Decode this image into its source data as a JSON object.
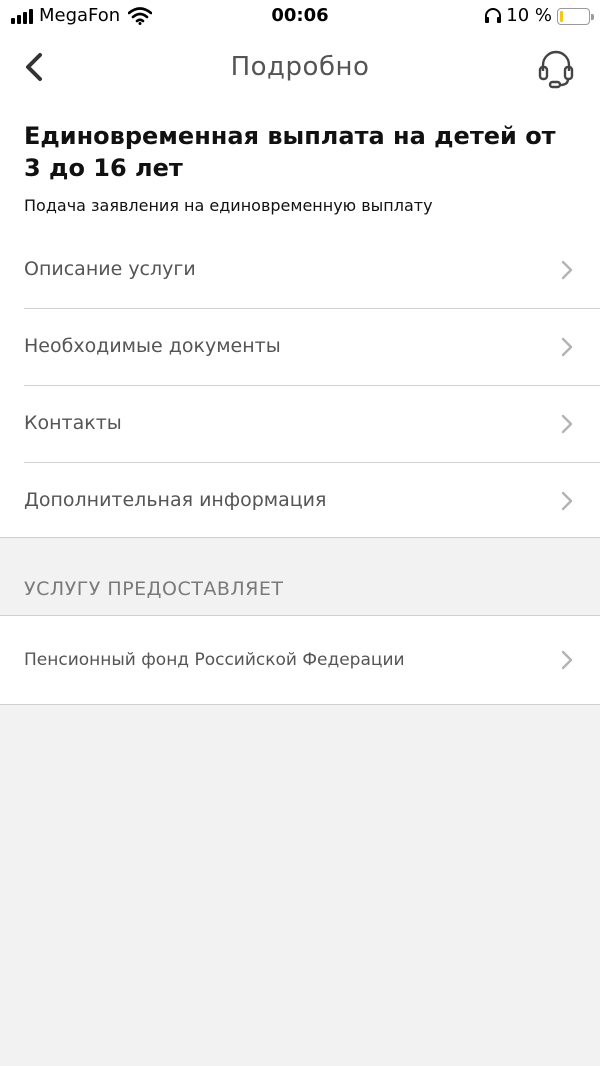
{
  "status_bar": {
    "carrier": "MegaFon",
    "time": "00:06",
    "battery_percent": "10 %",
    "battery_level": 0.1
  },
  "nav": {
    "title": "Подробно"
  },
  "header": {
    "title": "Единовременная выплата на детей от 3 до 16 лет",
    "subtitle": "Подача заявления на единовременную выплату"
  },
  "menu": {
    "items": [
      {
        "label": "Описание услуги"
      },
      {
        "label": "Необходимые документы"
      },
      {
        "label": "Контакты"
      },
      {
        "label": "Дополнительная информация"
      }
    ]
  },
  "provider_section": {
    "header": "УСЛУГУ ПРЕДОСТАВЛЯЕТ",
    "provider": "Пенсионный фонд Российской Федерации"
  },
  "colors": {
    "battery": "#f5c816",
    "background": "#f2f2f2"
  }
}
